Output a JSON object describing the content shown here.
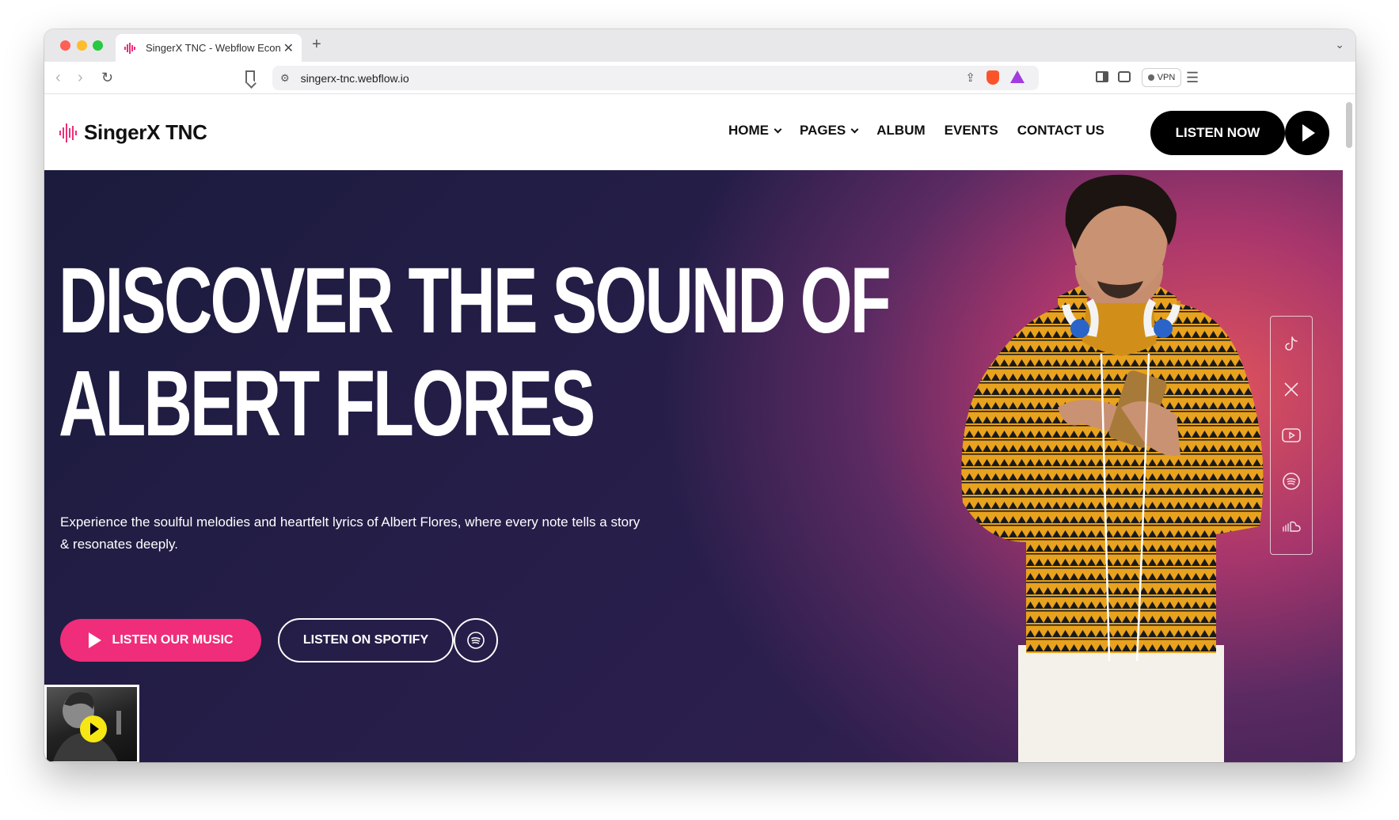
{
  "browser": {
    "tab_title": "SingerX TNC - Webflow Econ",
    "tab_close": "✕",
    "new_tab": "+",
    "url": "singerx-tnc.webflow.io",
    "vpn_label": "VPN"
  },
  "header": {
    "logo_text": "SingerX TNC",
    "nav": [
      {
        "label": "HOME",
        "dropdown": true
      },
      {
        "label": "PAGES",
        "dropdown": true
      },
      {
        "label": "ALBUM",
        "dropdown": false
      },
      {
        "label": "EVENTS",
        "dropdown": false
      },
      {
        "label": "CONTACT US",
        "dropdown": false
      }
    ],
    "cta_label": "LISTEN NOW"
  },
  "hero": {
    "title_line1": "DISCOVER THE SOUND OF",
    "title_line2": "ALBERT FLORES",
    "subtitle": "Experience the soulful melodies and heartfelt lyrics of Albert Flores, where every note tells a story & resonates deeply.",
    "primary_button": "LISTEN OUR MUSIC",
    "secondary_button": "LISTEN ON SPOTIFY"
  },
  "social": [
    "tiktok-icon",
    "x-icon",
    "youtube-icon",
    "spotify-icon",
    "soundcloud-icon"
  ],
  "colors": {
    "accent_pink": "#ef2d7a",
    "mini_play_yellow": "#f6e714",
    "sweater_yellow": "#e8a21e"
  }
}
